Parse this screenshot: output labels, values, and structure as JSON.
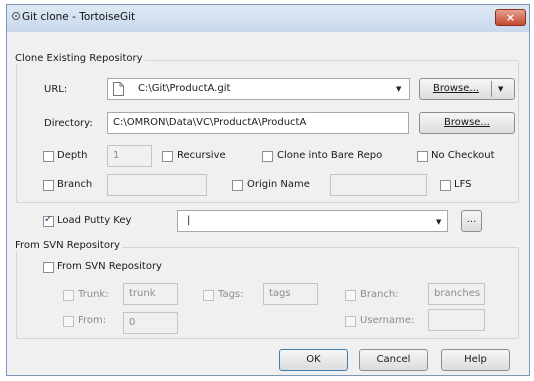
{
  "window": {
    "title": "Git clone - TortoiseGit",
    "close_label": "×"
  },
  "clone_group": {
    "legend": "Clone Existing Repository",
    "url_label": "URL:",
    "url_value": "C:\\Git\\ProductA.git",
    "browse_url_label": "Browse...",
    "directory_label": "Directory:",
    "directory_value": "C:\\OMRON\\Data\\VC\\ProductA\\ProductA",
    "browse_dir_label": "Browse...",
    "depth_label": "Depth",
    "depth_value": "1",
    "recursive_label": "Recursive",
    "bare_label": "Clone into Bare Repo",
    "no_checkout_label": "No Checkout",
    "branch_label": "Branch",
    "origin_label": "Origin Name",
    "lfs_label": "LFS"
  },
  "putty": {
    "label": "Load Putty Key",
    "checked": true,
    "value": "|",
    "browse_label": "..."
  },
  "svn_group": {
    "legend": "From SVN Repository",
    "checkbox_label": "From SVN Repository",
    "trunk_label": "Trunk:",
    "trunk_value": "trunk",
    "tags_label": "Tags:",
    "tags_value": "tags",
    "branch_label": "Branch:",
    "branch_value": "branches",
    "from_label": "From:",
    "from_value": "0",
    "username_label": "Username:",
    "username_value": ""
  },
  "footer": {
    "ok_label": "OK",
    "cancel_label": "Cancel",
    "help_label": "Help"
  },
  "icons": {
    "app": "tortoise-icon",
    "close": "close-icon",
    "dropdown": "chevron-down-icon",
    "file": "file-icon"
  }
}
